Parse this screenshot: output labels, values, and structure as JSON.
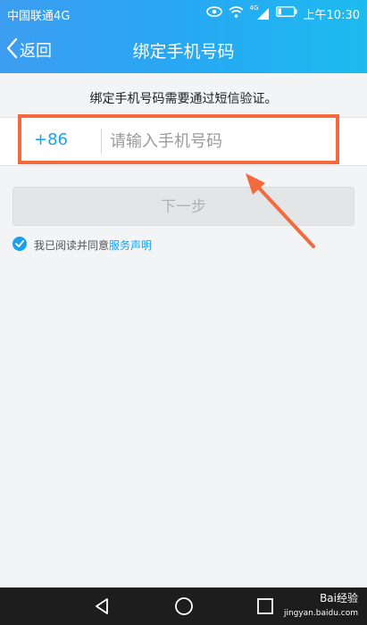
{
  "status_bar": {
    "carrier": "中国联通4G",
    "network_badge": "4G",
    "time": "上午10:30",
    "icons": [
      "eye-icon",
      "wifi-icon",
      "signal-icon",
      "battery-icon"
    ]
  },
  "header": {
    "back_label": "返回",
    "title": "绑定手机号码"
  },
  "info": {
    "text": "绑定手机号码需要通过短信验证。"
  },
  "phone": {
    "country_code": "+86",
    "placeholder": "请输入手机号码",
    "value": ""
  },
  "next_button": {
    "label": "下一步"
  },
  "agreement": {
    "text": "我已阅读并同意",
    "link": "服务声明",
    "checked": true
  },
  "watermark": {
    "brand": "Bai经验",
    "url": "jingyan.baidu.com"
  },
  "colors": {
    "accent": "#1aa0f0",
    "header_start": "#3d9df1",
    "header_end": "#1dbbf0",
    "highlight": "#f26a3d",
    "button_disabled": "#e4e5e7"
  }
}
